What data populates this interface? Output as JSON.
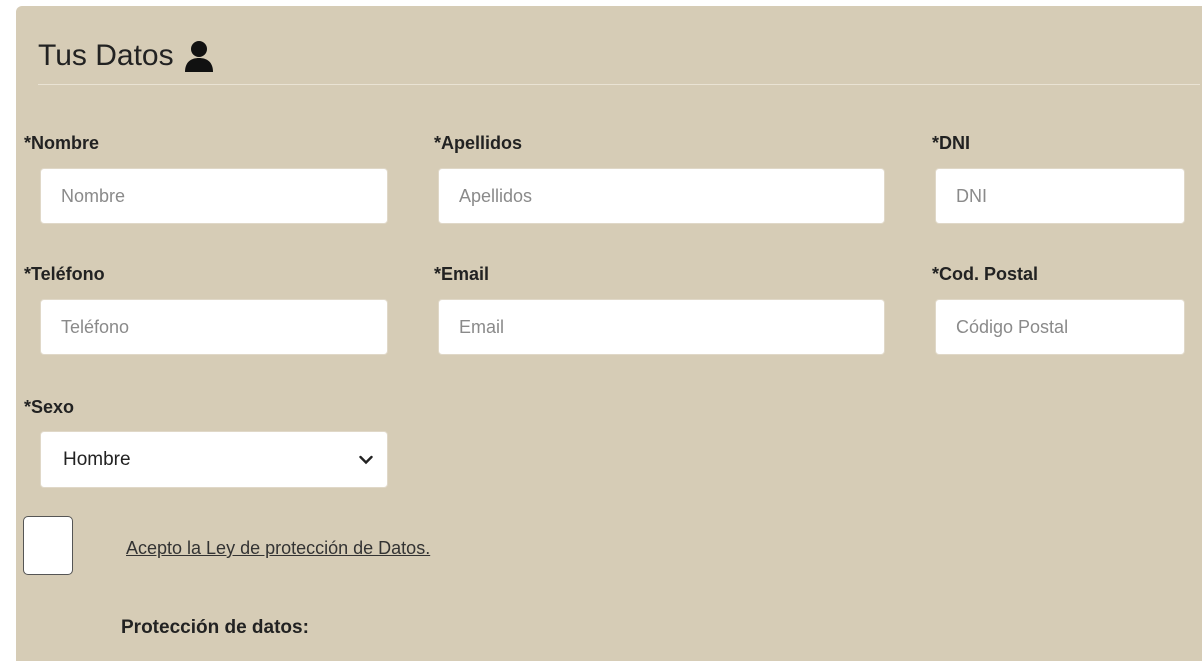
{
  "section": {
    "title": "Tus Datos",
    "icon": "user-icon"
  },
  "fields": {
    "nombre": {
      "label": "*Nombre",
      "placeholder": "Nombre"
    },
    "apellidos": {
      "label": "*Apellidos",
      "placeholder": "Apellidos"
    },
    "dni": {
      "label": "*DNI",
      "placeholder": "DNI"
    },
    "telefono": {
      "label": "*Teléfono",
      "placeholder": "Teléfono"
    },
    "email": {
      "label": "*Email",
      "placeholder": "Email"
    },
    "cod_postal": {
      "label": "*Cod. Postal",
      "placeholder": "Código Postal"
    },
    "sexo": {
      "label": "*Sexo",
      "selected": "Hombre"
    }
  },
  "consent": {
    "checked": false,
    "link_text": "Acepto la Ley de protección de Datos."
  },
  "protection": {
    "heading": "Protección de datos:"
  },
  "colors": {
    "panel_bg": "#d6ccb6",
    "field_bg": "#ffffff",
    "text": "#222222"
  }
}
